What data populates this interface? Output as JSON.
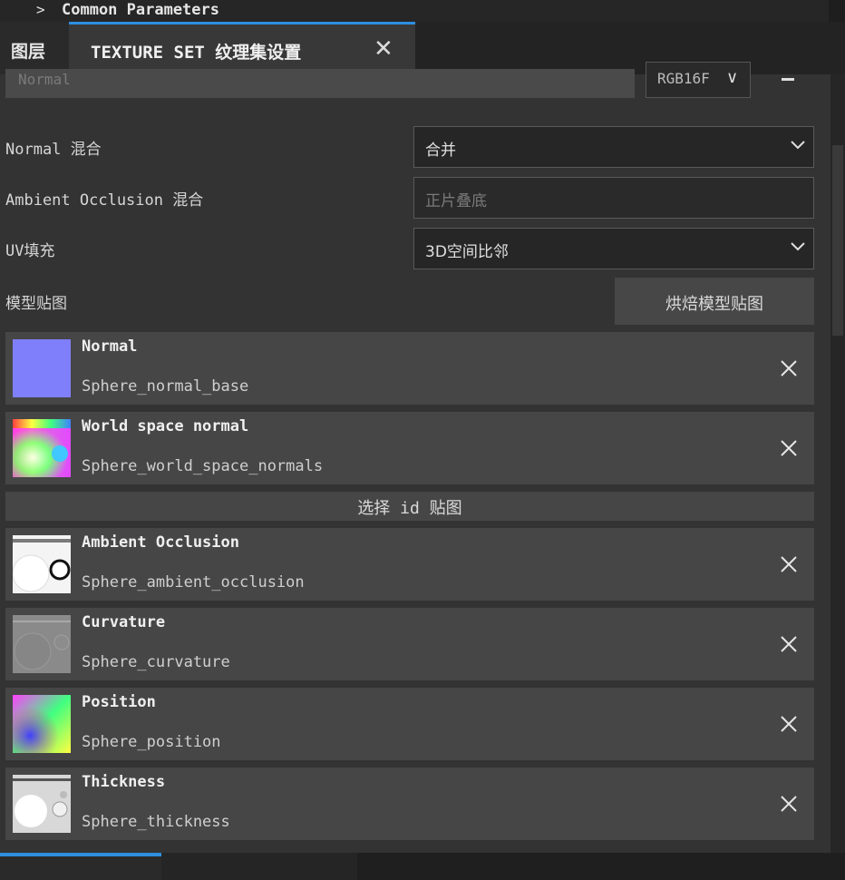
{
  "top_strip": {
    "chevron": ">",
    "label": "Common Parameters"
  },
  "tabs": {
    "layers_label": "图层",
    "active_label": "TEXTURE SET 纹理集设置",
    "close_glyph": "✕"
  },
  "normal_row": {
    "name_value": "Normal",
    "format_value": "RGB16F",
    "format_chevron": "∨",
    "remove_icon": "minus-icon"
  },
  "settings": {
    "normal_blend_label": "Normal 混合",
    "normal_blend_value": "合并",
    "ao_blend_label": "Ambient Occlusion 混合",
    "ao_blend_value": "正片叠底",
    "uv_padding_label": "UV填充",
    "uv_padding_value": "3D空间比邻",
    "mesh_maps_label": "模型贴图",
    "bake_button_label": "烘焙模型贴图"
  },
  "id_bar_label": "选择 id 贴图",
  "maps": [
    {
      "title": "Normal",
      "file": "Sphere_normal_base",
      "thumb": "normal-swatch"
    },
    {
      "title": "World space normal",
      "file": "Sphere_world_space_normals",
      "thumb": "world-normal"
    },
    {
      "title": "Ambient Occlusion",
      "file": "Sphere_ambient_occlusion",
      "thumb": "ambient-occlusion"
    },
    {
      "title": "Curvature",
      "file": "Sphere_curvature",
      "thumb": "curvature"
    },
    {
      "title": "Position",
      "file": "Sphere_position",
      "thumb": "position"
    },
    {
      "title": "Thickness",
      "file": "Sphere_thickness",
      "thumb": "thickness"
    }
  ],
  "colors": {
    "accent": "#2f8fe0",
    "normal_swatch": "#7f7ffc"
  }
}
